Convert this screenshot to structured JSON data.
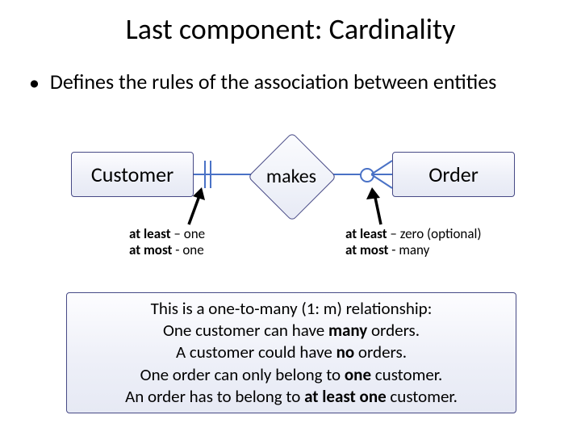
{
  "title": "Last component: Cardinality",
  "bullet": "Defines the rules of the association between entities",
  "er": {
    "customer": "Customer",
    "order": "Order",
    "relationship": "makes",
    "left_cardinality_name": "exactly-one-notation",
    "right_cardinality_name": "zero-or-many-notation",
    "left_caption_1": "at least",
    "left_caption_1v": " – one",
    "left_caption_2": "at most",
    "left_caption_2v": " - one",
    "right_caption_1": "at least",
    "right_caption_1v": " – zero (optional)",
    "right_caption_2": "at most",
    "right_caption_2v": " - many"
  },
  "explain": {
    "l1a": "This is a one-to-many (1: m) relationship:",
    "l2a": "One customer can have ",
    "l2b": "many ",
    "l2c": "orders.",
    "l3a": "A customer could have ",
    "l3b": "no ",
    "l3c": "orders.",
    "l4a": "One order can only belong to ",
    "l4b": "one ",
    "l4c": "customer.",
    "l5a": "An order has to belong to ",
    "l5b": "at least one ",
    "l5c": "customer."
  }
}
